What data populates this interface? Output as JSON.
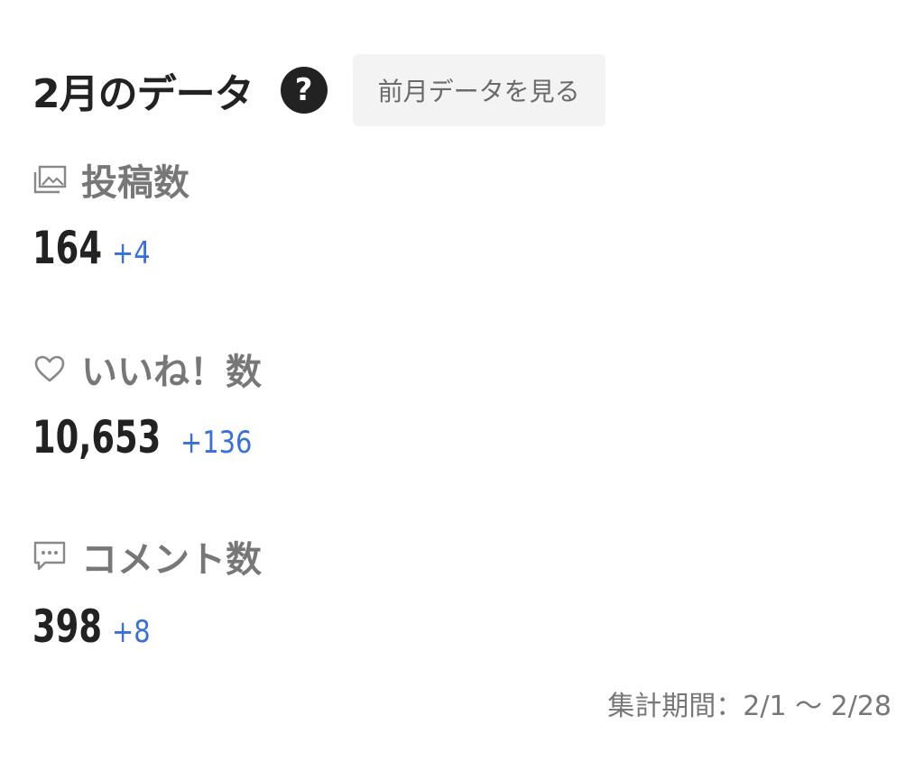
{
  "header": {
    "title": "2月のデータ",
    "help_icon": "question-circle-icon",
    "prev_button_label": "前月データを見る"
  },
  "stats": {
    "posts": {
      "icon": "photo-stack-icon",
      "label": "投稿数",
      "value": "164",
      "diff": "+4"
    },
    "likes": {
      "icon": "heart-icon",
      "label": "いいね！数",
      "value": "10,653",
      "diff": "+136"
    },
    "comments": {
      "icon": "comment-bubble-icon",
      "label": "コメント数",
      "value": "398",
      "diff": "+8"
    }
  },
  "footer": {
    "period": "集計期間：2/1 〜 2/28"
  },
  "colors": {
    "text_primary": "#222222",
    "text_secondary": "#777777",
    "accent_diff": "#3a6fd8",
    "button_bg": "#f3f3f3"
  }
}
